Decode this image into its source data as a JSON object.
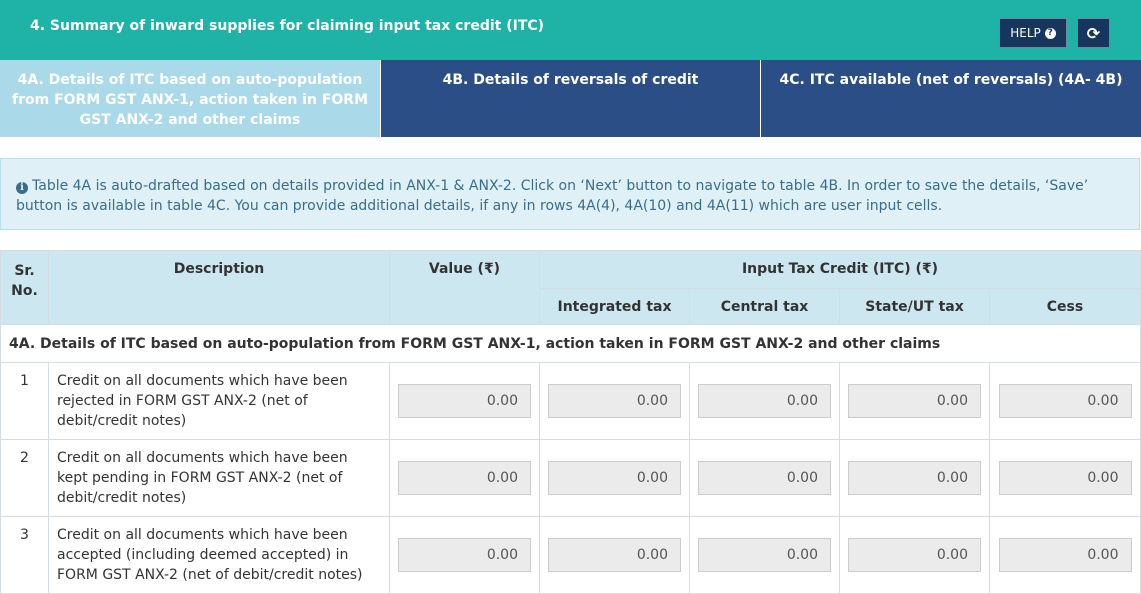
{
  "header": {
    "title": "4. Summary of inward supplies for claiming input tax credit (ITC)",
    "help_label": "HELP",
    "refresh_icon": "refresh-icon"
  },
  "tabs": [
    {
      "label": "4A. Details of ITC based on auto-population from FORM GST ANX-1, action taken in FORM GST ANX-2 and other claims",
      "active": true
    },
    {
      "label": "4B. Details of reversals of credit",
      "active": false
    },
    {
      "label": "4C. ITC available (net of reversals) (4A- 4B)",
      "active": false
    }
  ],
  "info": {
    "text": "Table 4A is auto-drafted based on details provided in ANX-1 & ANX-2. Click on ‘Next’ button to navigate to table 4B. In order to save the details, ‘Save’ button is available in table 4C. You can provide additional details, if any in rows 4A(4), 4A(10) and 4A(11) which are user input cells."
  },
  "table": {
    "headers": {
      "sr": "Sr. No.",
      "description": "Description",
      "value": "Value (₹)",
      "itc": "Input Tax Credit (ITC) (₹)",
      "integrated": "Integrated tax",
      "central": "Central tax",
      "state": "State/UT tax",
      "cess": "Cess"
    },
    "section_title": "4A. Details of ITC based on auto-population from FORM GST ANX-1, action taken in FORM GST ANX-2 and other claims",
    "rows": [
      {
        "sr": "1",
        "description": "Credit on all documents which have been rejected in FORM GST ANX-2 (net of debit/credit notes)",
        "value": "0.00",
        "integrated": "0.00",
        "central": "0.00",
        "state": "0.00",
        "cess": "0.00"
      },
      {
        "sr": "2",
        "description": "Credit on all documents which have been kept pending in FORM GST ANX-2 (net of debit/credit notes)",
        "value": "0.00",
        "integrated": "0.00",
        "central": "0.00",
        "state": "0.00",
        "cess": "0.00"
      },
      {
        "sr": "3",
        "description": "Credit on all documents which have been accepted (including deemed accepted) in FORM GST ANX-2 (net of debit/credit notes)",
        "value": "0.00",
        "integrated": "0.00",
        "central": "0.00",
        "state": "0.00",
        "cess": "0.00"
      }
    ]
  }
}
